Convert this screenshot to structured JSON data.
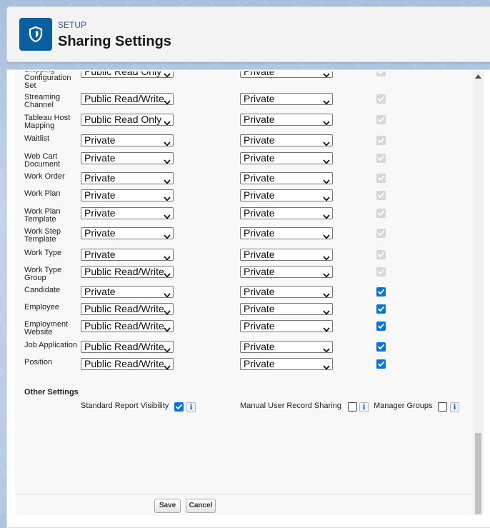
{
  "header": {
    "eyebrow": "SETUP",
    "title": "Sharing Settings"
  },
  "rows": [
    {
      "label": "Shipping Configuration Set",
      "default_access": "Public Read Only",
      "external_access": "Private",
      "grant_access": "disabled-checked"
    },
    {
      "label": "Streaming Channel",
      "default_access": "Public Read/Write",
      "external_access": "Private",
      "grant_access": "disabled-checked"
    },
    {
      "label": "Tableau Host Mapping",
      "default_access": "Public Read Only",
      "external_access": "Private",
      "grant_access": "disabled-checked"
    },
    {
      "label": "Waitlist",
      "default_access": "Private",
      "external_access": "Private",
      "grant_access": "disabled-checked"
    },
    {
      "label": "Web Cart Document",
      "default_access": "Private",
      "external_access": "Private",
      "grant_access": "disabled-checked"
    },
    {
      "label": "Work Order",
      "default_access": "Private",
      "external_access": "Private",
      "grant_access": "disabled-checked"
    },
    {
      "label": "Work Plan",
      "default_access": "Private",
      "external_access": "Private",
      "grant_access": "disabled-checked"
    },
    {
      "label": "Work Plan Template",
      "default_access": "Private",
      "external_access": "Private",
      "grant_access": "disabled-checked"
    },
    {
      "label": "Work Step Template",
      "default_access": "Private",
      "external_access": "Private",
      "grant_access": "disabled-checked"
    },
    {
      "label": "Work Type",
      "default_access": "Private",
      "external_access": "Private",
      "grant_access": "disabled-checked"
    },
    {
      "label": "Work Type Group",
      "default_access": "Public Read/Write",
      "external_access": "Private",
      "grant_access": "disabled-checked"
    },
    {
      "label": "Candidate",
      "default_access": "Private",
      "external_access": "Private",
      "grant_access": "checked"
    },
    {
      "label": "Employee",
      "default_access": "Public Read/Write",
      "external_access": "Private",
      "grant_access": "checked"
    },
    {
      "label": "Employment Website",
      "default_access": "Public Read/Write",
      "external_access": "Private",
      "grant_access": "checked"
    },
    {
      "label": "Job Application",
      "default_access": "Public Read/Write",
      "external_access": "Private",
      "grant_access": "checked"
    },
    {
      "label": "Position",
      "default_access": "Public Read/Write",
      "external_access": "Private",
      "grant_access": "checked"
    }
  ],
  "other_settings": {
    "title": "Other Settings",
    "standard_report_visibility": {
      "label": "Standard Report Visibility",
      "checked": true
    },
    "manual_user_record_sharing": {
      "label": "Manual User Record Sharing",
      "checked": false
    },
    "manager_groups": {
      "label": "Manager Groups",
      "checked": false
    },
    "info_glyph": "i"
  },
  "buttons": {
    "save": "Save",
    "cancel": "Cancel"
  },
  "colors": {
    "brand_icon": "#0b5f9c",
    "checkbox_checked": "#0a74d9",
    "checkbox_disabled": "#d6d6d6"
  }
}
